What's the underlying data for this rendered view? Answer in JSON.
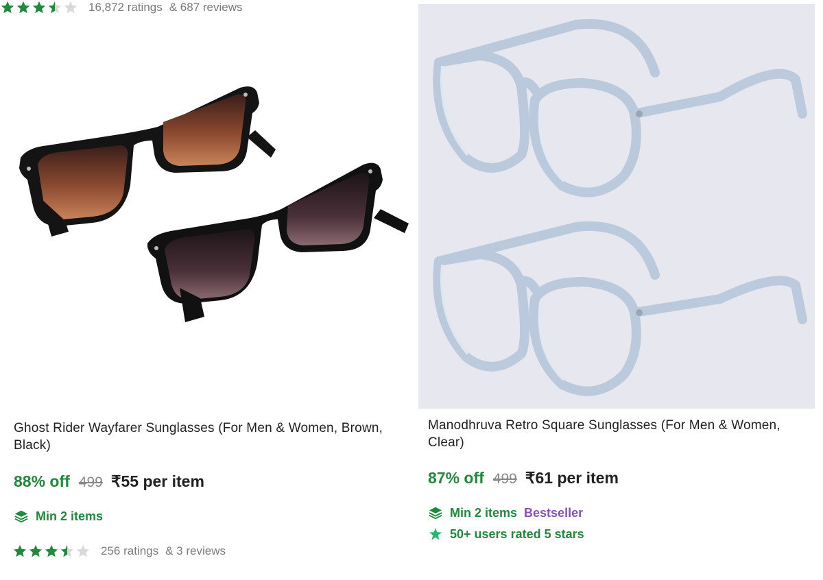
{
  "colors": {
    "accent_green": "#1f8a3b",
    "bestseller_purple": "#8a4ec1",
    "muted_gray": "#878787",
    "star_empty": "#d9d9d9"
  },
  "products": [
    {
      "title": "Ghost Rider Wayfarer Sunglasses (For Men & Women, Brown, Black)",
      "discount": "88% off",
      "mrp": "499",
      "price": "₹55 per item",
      "min_items": "Min 2 items",
      "rating_value": 3.5,
      "ratings_text": "256 ratings",
      "reviews_text": "& 3 reviews"
    },
    {
      "title": "Manodhruva Retro Square Sunglasses (For Men & Women, Clear)",
      "discount": "87% off",
      "mrp": "499",
      "price": "₹61 per item",
      "min_items": "Min 2 items",
      "badge": "Bestseller",
      "rated_text": "50+ users rated 5 stars",
      "rating_value": 3.5,
      "ratings_text": "16,872 ratings",
      "reviews_text": "& 687 reviews"
    }
  ]
}
